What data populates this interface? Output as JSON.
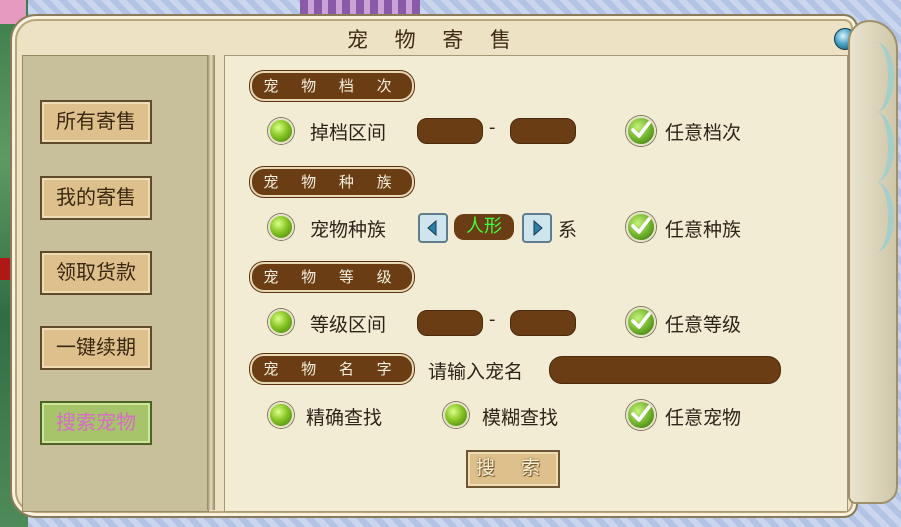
{
  "window": {
    "title": "宠 物 寄 售"
  },
  "sidebar": {
    "items": [
      {
        "label": "所有寄售"
      },
      {
        "label": "我的寄售"
      },
      {
        "label": "领取货款"
      },
      {
        "label": "一键续期"
      },
      {
        "label": "搜索宠物",
        "active": true
      }
    ]
  },
  "grade": {
    "heading": "宠 物 档 次",
    "range_label": "掉档区间",
    "dash": "-",
    "any_label": "任意档次",
    "any_checked": true
  },
  "race": {
    "heading": "宠 物 种 族",
    "race_label": "宠物种族",
    "value": "人形",
    "suffix": "系",
    "any_label": "任意种族",
    "any_checked": true
  },
  "level": {
    "heading": "宠 物 等 级",
    "range_label": "等级区间",
    "dash": "-",
    "any_label": "任意等级",
    "any_checked": true
  },
  "name": {
    "heading": "宠 物 名 字",
    "prompt": "请输入宠名",
    "exact_label": "精确查找",
    "fuzzy_label": "模糊查找",
    "any_label": "任意宠物",
    "any_checked": true
  },
  "search_button": {
    "label": "搜 索"
  },
  "colors": {
    "panel_bg": "#ede2c3",
    "pill_brown": "#6a3d14",
    "button_gold": "#dec08d",
    "active_green": "#a7c46a",
    "active_text": "#d86cc8",
    "race_value_text": "#3cff3c"
  }
}
